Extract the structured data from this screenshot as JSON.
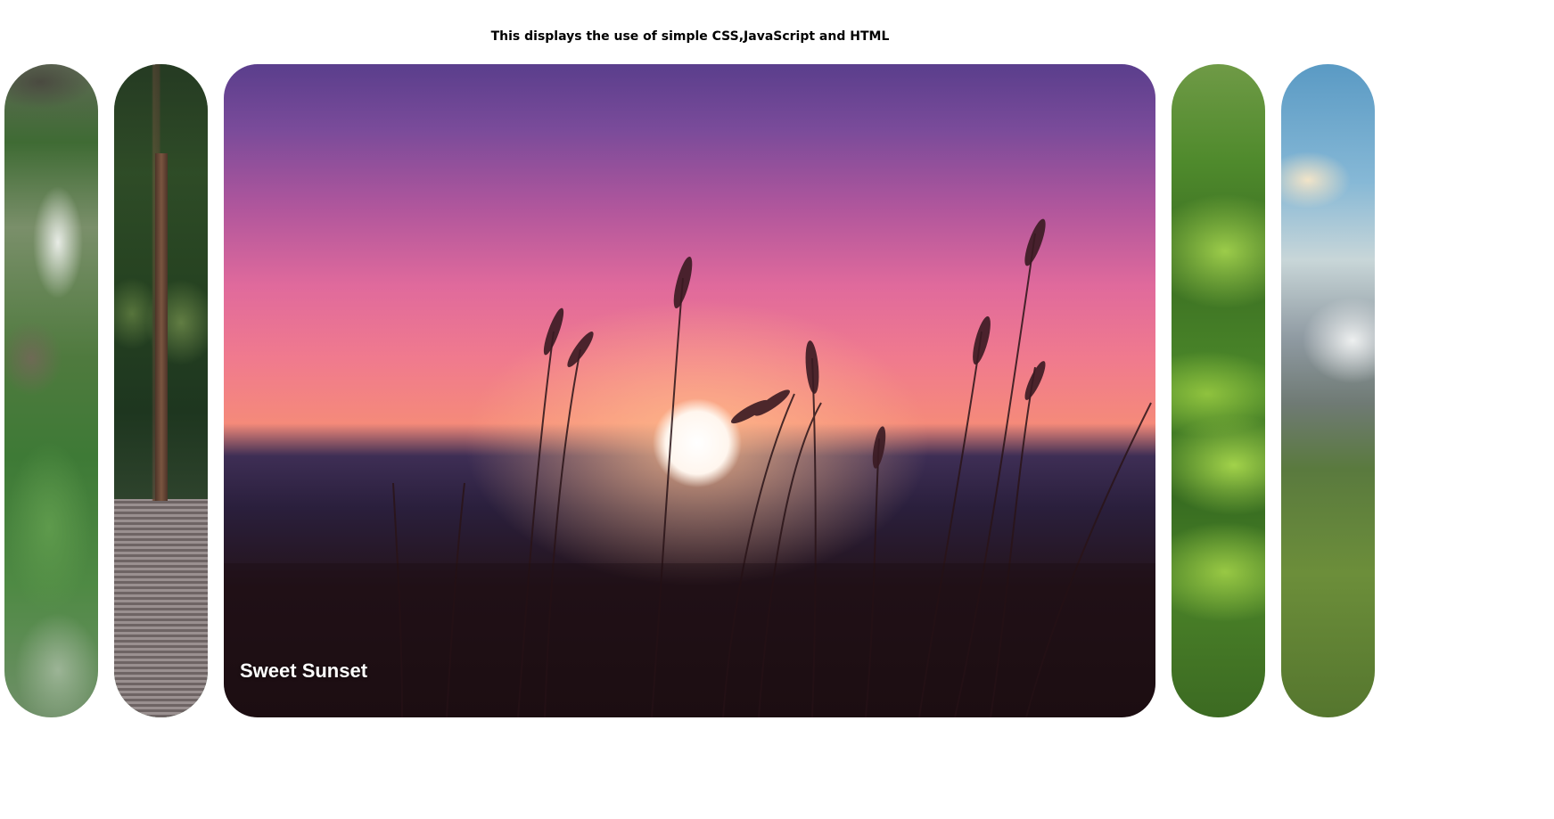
{
  "page": {
    "heading": "This displays the use of simple CSS,JavaScript and HTML"
  },
  "panels": [
    {
      "id": "p1",
      "title": "",
      "scene": "forest path",
      "active": false
    },
    {
      "id": "p2",
      "title": "",
      "scene": "forest bridge",
      "active": false
    },
    {
      "id": "p3",
      "title": "Sweet Sunset",
      "scene": "sunset over grass",
      "active": true
    },
    {
      "id": "p4",
      "title": "",
      "scene": "green hills",
      "active": false
    },
    {
      "id": "p5",
      "title": "",
      "scene": "mountain sky",
      "active": false
    }
  ]
}
